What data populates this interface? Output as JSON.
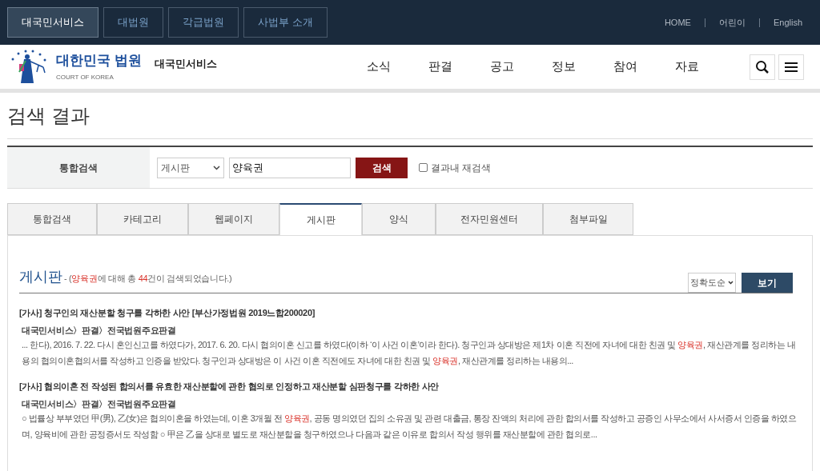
{
  "top_bar": {
    "site_tabs": [
      {
        "label": "대국민서비스",
        "selected": true
      },
      {
        "label": "대법원",
        "selected": false
      },
      {
        "label": "각급법원",
        "selected": false
      },
      {
        "label": "사법부 소개",
        "selected": false
      }
    ],
    "links": [
      "HOME",
      "어린이",
      "English"
    ]
  },
  "header": {
    "logo_title": "대한민국 법원",
    "logo_subtitle": "COURT OF KOREA",
    "service_name": "대국민서비스",
    "nav": [
      "소식",
      "판결",
      "공고",
      "정보",
      "참여",
      "자료"
    ]
  },
  "page_title": "검색 결과",
  "search": {
    "label": "통합검색",
    "scope": "게시판",
    "query": "양육권",
    "button": "검색",
    "research": {
      "label": "결과내 재검색",
      "checked": false
    }
  },
  "tabs": [
    {
      "label": "통합검색",
      "selected": false
    },
    {
      "label": "카테고리",
      "selected": false
    },
    {
      "label": "웹페이지",
      "selected": false
    },
    {
      "label": "게시판",
      "selected": true
    },
    {
      "label": "양식",
      "selected": false
    },
    {
      "label": "전자민원센터",
      "selected": false
    },
    {
      "label": "첨부파일",
      "selected": false
    }
  ],
  "results": {
    "heading": "게시판",
    "summary": [
      {
        "text": " - (",
        "highlight": false
      },
      {
        "text": "양육권",
        "highlight": true
      },
      {
        "text": "에 대해 총 ",
        "highlight": false
      },
      {
        "text": "44",
        "highlight": true
      },
      {
        "text": "건이 검색되었습니다.)",
        "highlight": false
      }
    ],
    "sort": "정확도순",
    "view_button": "보기",
    "items": [
      {
        "title": "[가사] 청구인의 재산분할 청구를 각하한 사안 [부산가정법원 2019느합200020]",
        "path": "대국민서비스〉판결〉전국법원주요판결",
        "snippet": [
          {
            "text": "... 한다), 2016. 7. 22. 다시 혼인신고를 하였다가, 2017. 6. 20. 다시 협의이혼 신고를 하였다(이하 ‘이 사건 이혼’이라 한다). 청구인과 상대방은 제1차 이혼 직전에 자녀에 대한 친권 및 ",
            "highlight": false
          },
          {
            "text": "양육권",
            "highlight": true
          },
          {
            "text": ", 재산관계를 정리하는 내용의 협의이혼협의서를 작성하고 인증을 받았다. 청구인과 상대방은 이 사건 이혼 직전에도 자녀에 대한 친권 및 ",
            "highlight": false
          },
          {
            "text": "양육권",
            "highlight": true
          },
          {
            "text": ", 재산관계를 정리하는 내용의...",
            "highlight": false
          }
        ]
      },
      {
        "title": "[가사] 협의이혼 전 작성된 합의서를 유효한 재산분할에 관한 협의로 인정하고 재산분할 심판청구를 각하한 사안",
        "path": "대국민서비스〉판결〉전국법원주요판결",
        "snippet": [
          {
            "text": "○ 법률상 부부였던 甲(男), 乙(女)은 협의이혼을 하였는데, 이혼 3개월 전 ",
            "highlight": false
          },
          {
            "text": "양육권",
            "highlight": true
          },
          {
            "text": ", 공동 명의였던 집의 소유권 및 관련 대출금, 통장 잔액의 처리에 관한 합의서를 작성하고 공증인 사무소에서 사서증서 인증을 하였으며, 양육비에 관한 공정증서도 작성함 ○ 甲은 乙을 상대로 별도로 재산분할을 청구하였으나 다음과 같은 이유로 합의서 작성 행위를 재산분할에 관한 협의로...",
            "highlight": false
          }
        ]
      }
    ]
  }
}
